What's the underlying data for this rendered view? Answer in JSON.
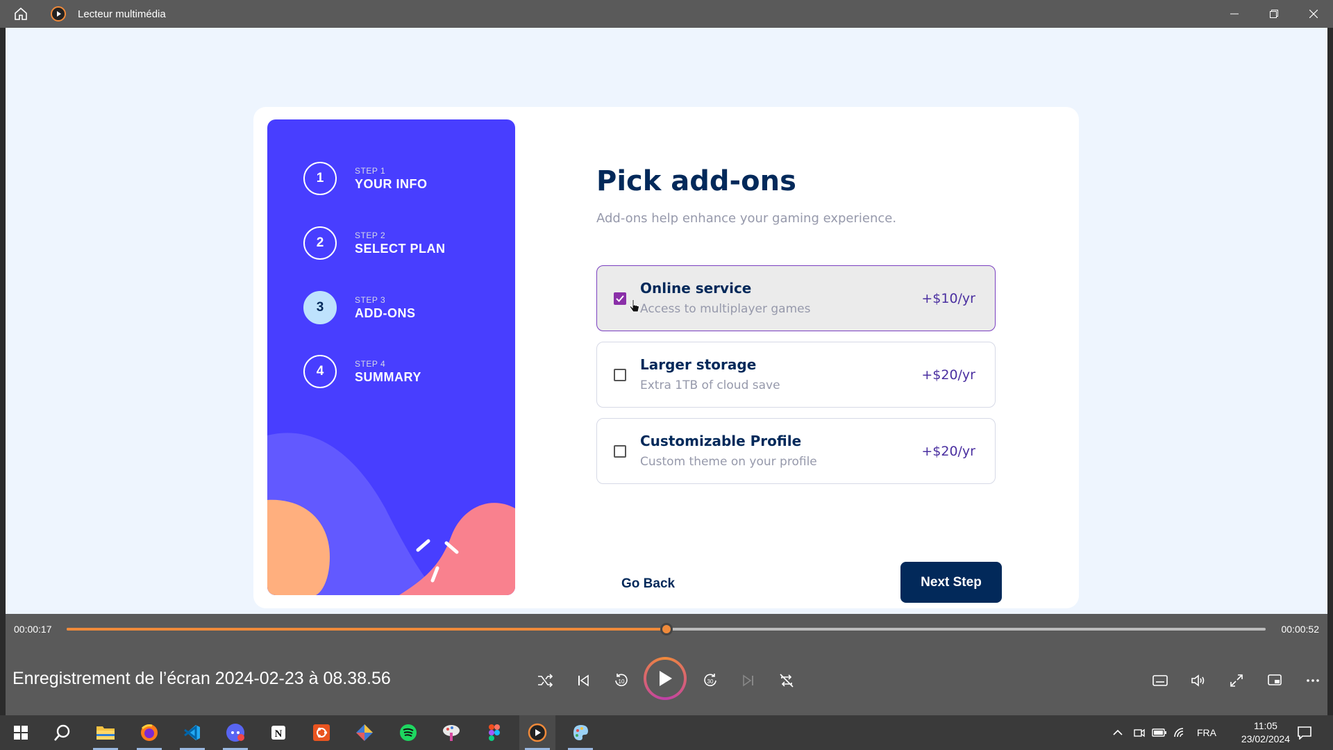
{
  "window": {
    "title": "Lecteur multimédia"
  },
  "form": {
    "steps": [
      {
        "number": "1",
        "label": "STEP 1",
        "name": "YOUR INFO"
      },
      {
        "number": "2",
        "label": "STEP 2",
        "name": "SELECT PLAN"
      },
      {
        "number": "3",
        "label": "STEP 3",
        "name": "ADD-ONS"
      },
      {
        "number": "4",
        "label": "STEP 4",
        "name": "SUMMARY"
      }
    ],
    "active_step": 3,
    "title": "Pick add-ons",
    "subtitle": "Add-ons help enhance your gaming experience.",
    "addons": [
      {
        "name": "Online service",
        "description": "Access to multiplayer games",
        "price": "+$10/yr",
        "checked": true
      },
      {
        "name": "Larger storage",
        "description": "Extra 1TB of cloud save",
        "price": "+$20/yr",
        "checked": false
      },
      {
        "name": "Customizable Profile",
        "description": "Custom theme on your profile",
        "price": "+$20/yr",
        "checked": false
      }
    ],
    "back_label": "Go Back",
    "next_label": "Next Step"
  },
  "player": {
    "elapsed": "00:00:17",
    "duration": "00:00:52",
    "progress": 0.5,
    "media_title": "Enregistrement de l’écran 2024-02-23 à 08.38.56",
    "accent": "#f08a3a"
  },
  "taskbar": {
    "language": "FRA",
    "time": "11:05",
    "date": "23/02/2024"
  }
}
